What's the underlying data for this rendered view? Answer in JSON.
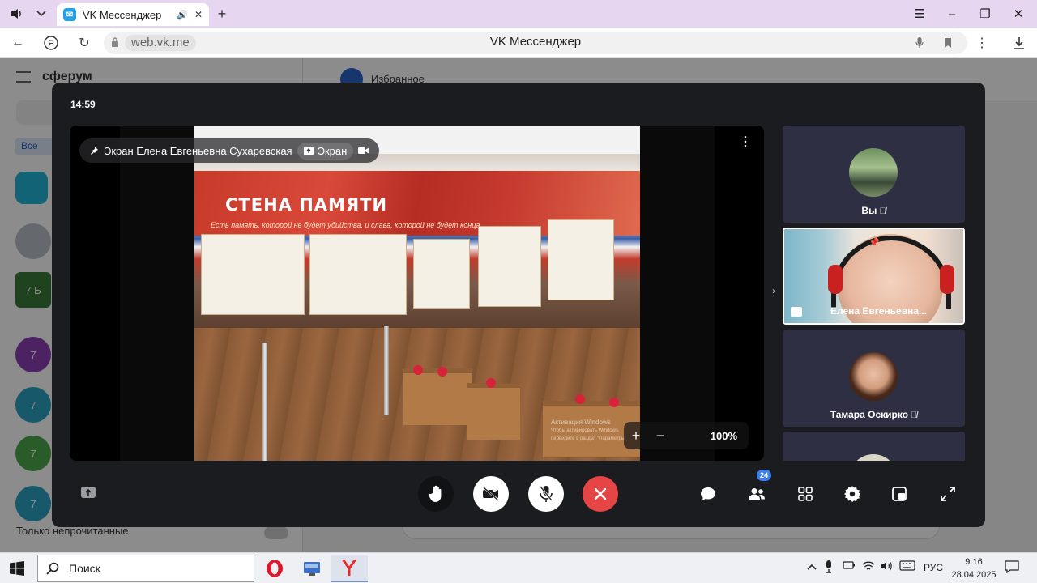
{
  "browser": {
    "tab_title": "VK Мессенджер",
    "url": "web.vk.me",
    "page_title": "VK Мессенджер"
  },
  "background_app": {
    "logo": "сферум",
    "filter_all": "Все",
    "conversation_title": "Избранное",
    "unread_only": "Только непрочитанные",
    "chat_avatar_label": "7 Б",
    "list_avatar_label": "7"
  },
  "call": {
    "time": "14:59",
    "pinned_label": "Экран Елена Евгеньевна Сухаревская",
    "screen_chip": "Экран",
    "zoom_value": "100%",
    "participants_count": "24",
    "shared_screen": {
      "banner_title": "СТЕНА ПАМЯТИ",
      "banner_subtitle": "Есть память, которой не будет убийства, и слава, которой не будет конца...",
      "watermark_line1": "Активация Windows",
      "watermark_line2": "Чтобы активировать Windows, перейдите в раздел \"Параметры\"."
    },
    "tiles": [
      {
        "name": "Вы",
        "muted": true
      },
      {
        "name": "Елена Евгеньевна...",
        "muted": false,
        "active": true
      },
      {
        "name": "Тамара Оскирко",
        "muted": true
      },
      {
        "name": "",
        "muted": false
      }
    ]
  },
  "taskbar": {
    "search_placeholder": "Поиск",
    "language": "РУС",
    "time": "9:16",
    "date": "28.04.2025"
  },
  "colors": {
    "call_bg": "#1b1c1f",
    "tile_bg": "#2e2f43",
    "end_call": "#e64545",
    "badge": "#3a7ff0",
    "titlebar": "#e6d6ef"
  }
}
